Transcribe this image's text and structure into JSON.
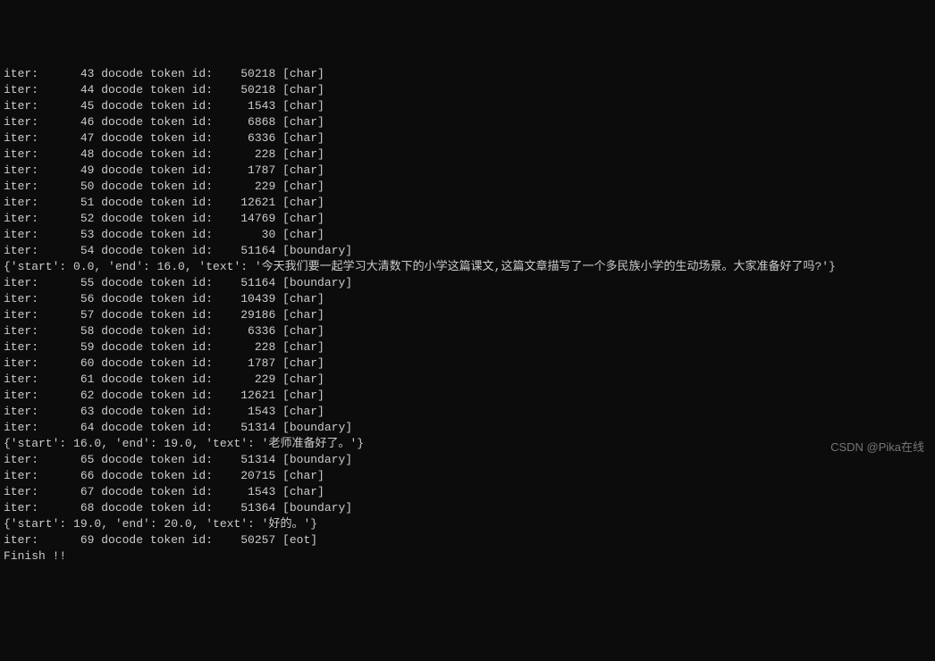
{
  "lines": [
    {
      "type": "cut",
      "text": "iter:      43 docode token id:    50218 [char]"
    },
    {
      "type": "iter",
      "iter": 44,
      "id": 50218,
      "tag": "[char]"
    },
    {
      "type": "iter",
      "iter": 45,
      "id": 1543,
      "tag": "[char]"
    },
    {
      "type": "iter",
      "iter": 46,
      "id": 6868,
      "tag": "[char]"
    },
    {
      "type": "iter",
      "iter": 47,
      "id": 6336,
      "tag": "[char]"
    },
    {
      "type": "iter",
      "iter": 48,
      "id": 228,
      "tag": "[char]"
    },
    {
      "type": "iter",
      "iter": 49,
      "id": 1787,
      "tag": "[char]"
    },
    {
      "type": "iter",
      "iter": 50,
      "id": 229,
      "tag": "[char]"
    },
    {
      "type": "iter",
      "iter": 51,
      "id": 12621,
      "tag": "[char]"
    },
    {
      "type": "iter",
      "iter": 52,
      "id": 14769,
      "tag": "[char]"
    },
    {
      "type": "iter",
      "iter": 53,
      "id": 30,
      "tag": "[char]"
    },
    {
      "type": "iter",
      "iter": 54,
      "id": 51164,
      "tag": "[boundary]"
    },
    {
      "type": "dict",
      "start": "0.0",
      "end": "16.0",
      "text_val": "今天我们要一起学习大清数下的小学这篇课文,这篇文章描写了一个多民族小学的生动场景。大家准备好了吗?"
    },
    {
      "type": "iter",
      "iter": 55,
      "id": 51164,
      "tag": "[boundary]"
    },
    {
      "type": "iter",
      "iter": 56,
      "id": 10439,
      "tag": "[char]"
    },
    {
      "type": "iter",
      "iter": 57,
      "id": 29186,
      "tag": "[char]"
    },
    {
      "type": "iter",
      "iter": 58,
      "id": 6336,
      "tag": "[char]"
    },
    {
      "type": "iter",
      "iter": 59,
      "id": 228,
      "tag": "[char]"
    },
    {
      "type": "iter",
      "iter": 60,
      "id": 1787,
      "tag": "[char]"
    },
    {
      "type": "iter",
      "iter": 61,
      "id": 229,
      "tag": "[char]"
    },
    {
      "type": "iter",
      "iter": 62,
      "id": 12621,
      "tag": "[char]"
    },
    {
      "type": "iter",
      "iter": 63,
      "id": 1543,
      "tag": "[char]"
    },
    {
      "type": "iter",
      "iter": 64,
      "id": 51314,
      "tag": "[boundary]"
    },
    {
      "type": "dict",
      "start": "16.0",
      "end": "19.0",
      "text_val": "老师准备好了。"
    },
    {
      "type": "iter",
      "iter": 65,
      "id": 51314,
      "tag": "[boundary]"
    },
    {
      "type": "iter",
      "iter": 66,
      "id": 20715,
      "tag": "[char]"
    },
    {
      "type": "iter",
      "iter": 67,
      "id": 1543,
      "tag": "[char]"
    },
    {
      "type": "iter",
      "iter": 68,
      "id": 51364,
      "tag": "[boundary]"
    },
    {
      "type": "dict",
      "start": "19.0",
      "end": "20.0",
      "text_val": "好的。"
    },
    {
      "type": "iter",
      "iter": 69,
      "id": 50257,
      "tag": "[eot]"
    },
    {
      "type": "plain",
      "text": "Finish !!"
    }
  ],
  "watermark": "CSDN @Pika在线"
}
